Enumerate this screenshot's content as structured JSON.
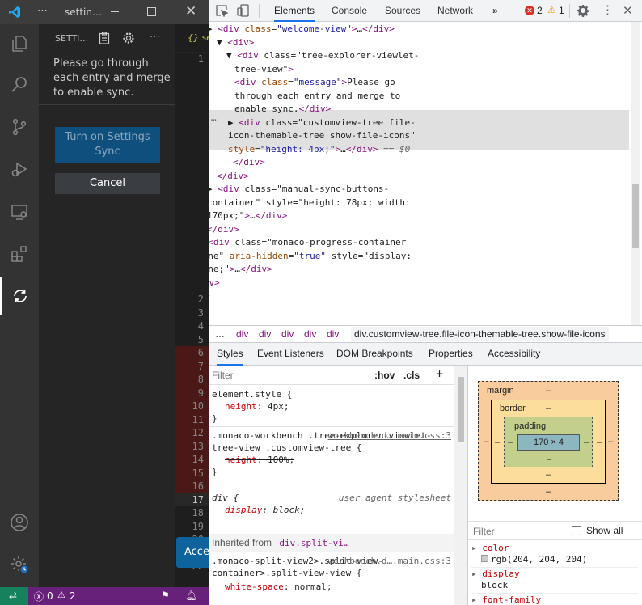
{
  "vscode": {
    "title": "settin…",
    "sidebar": {
      "header": "SETTI…",
      "message": "Please go through each entry and merge to enable sync.",
      "primary_button": "Turn on Settings Sync",
      "cancel_button": "Cancel"
    },
    "editor": {
      "tab_label": "{} se",
      "line_numbers": [
        "1",
        "2",
        "3",
        "4",
        "5",
        "6",
        "7",
        "8",
        "9",
        "10",
        "11",
        "12",
        "13",
        "14",
        "15",
        "16",
        "17",
        "18",
        "19",
        "20",
        "21",
        "22"
      ],
      "accept_button": "Accep"
    },
    "status": {
      "errors": "0",
      "warnings": "2"
    }
  },
  "devtools": {
    "tabs": [
      "Elements",
      "Console",
      "Sources",
      "Network"
    ],
    "more": "»",
    "errors": "2",
    "warnings": "1",
    "dom": [
      {
        "i": 0,
        "t": "▶ <div class=\"welcome-view\">…</div>"
      },
      {
        "i": 0,
        "t": "▼ <div>"
      },
      {
        "i": 1,
        "t": "▼ <div class=\"tree-explorer-viewlet-"
      },
      {
        "i": 2,
        "t": "tree-view\">"
      },
      {
        "i": 3,
        "t": "<div class=\"message\">Please go"
      },
      {
        "i": 3,
        "t": "through each entry and merge to"
      },
      {
        "i": 3,
        "t": "enable sync.</div>"
      },
      {
        "i": 2,
        "t": "▶ <div class=\"customview-tree file-"
      },
      {
        "i": 3,
        "t": "icon-themable-tree show-file-icons\""
      },
      {
        "i": 3,
        "t": "style=\"height: 4px;\">…</div> == $0"
      },
      {
        "i": 3,
        "t": "</div>"
      },
      {
        "i": 2,
        "t": "</div>"
      },
      {
        "i": 1,
        "t": "▶ <div class=\"manual-sync-buttons-"
      },
      {
        "i": 2,
        "t": "container\" style=\"height: 78px; width:"
      },
      {
        "i": 2,
        "t": "170px;\">…</div>"
      },
      {
        "i": 2,
        "t": "</div>"
      },
      {
        "i": 0,
        "t": "▶ <div class=\"monaco-progress-container"
      },
      {
        "i": 0,
        "t": "done\" aria-hidden=\"true\" style=\"display:"
      },
      {
        "i": 0,
        "t": "none;\">…</div>"
      },
      {
        "i": 1,
        "t": "</div>"
      },
      {
        "i": 0,
        "t": "</div>"
      },
      {
        "i": 0,
        "t": "</div>"
      },
      {
        "i": 0,
        "t": "</div>"
      }
    ],
    "ellipsis": "…",
    "breadcrumbs": [
      "…",
      "div",
      "div",
      "div",
      "div",
      "div",
      "div.customview-tree.file-icon-themable-tree.show-file-icons"
    ],
    "subtabs": [
      "Styles",
      "Event Listeners",
      "DOM Breakpoints",
      "Properties",
      "Accessibility"
    ],
    "filter_placeholder": "Filter",
    "hov": ":hov",
    "cls": ".cls",
    "plus": "+",
    "rules": [
      {
        "selector": "element.style {",
        "props": [
          {
            "n": "height",
            "v": "4px;"
          }
        ],
        "close": "}",
        "src": ""
      },
      {
        "selector": ".monaco-workbench .tree-explorer-viewlet-tree-view .customview-tree {",
        "props": [
          {
            "n": "height",
            "v": "100%;",
            "struck": true
          }
        ],
        "close": "}",
        "src": "workbench.d….main.css:3"
      },
      {
        "selector": "div {",
        "props": [
          {
            "n": "display",
            "v": "block;"
          }
        ],
        "close": "}",
        "src": "user agent stylesheet"
      }
    ],
    "inherited_label": "Inherited from",
    "inherited_from": "div.split-vi…",
    "rule4": {
      "selector": ".monaco-split-view2>.split-view-container>.split-view-view {",
      "prop": "white-space",
      "val": "normal;",
      "src": "workbench.d….main.css:3"
    },
    "box": {
      "margin": "margin",
      "border": "border",
      "padding": "padding",
      "content": "170 × 4",
      "dash": "–"
    },
    "computed_filter": "Filter",
    "show_all": "Show all",
    "computed": [
      {
        "n": "color",
        "v": "rgb(204, 204, 204)"
      },
      {
        "n": "display",
        "v": "block"
      },
      {
        "n": "font-family",
        "v": ""
      }
    ]
  }
}
